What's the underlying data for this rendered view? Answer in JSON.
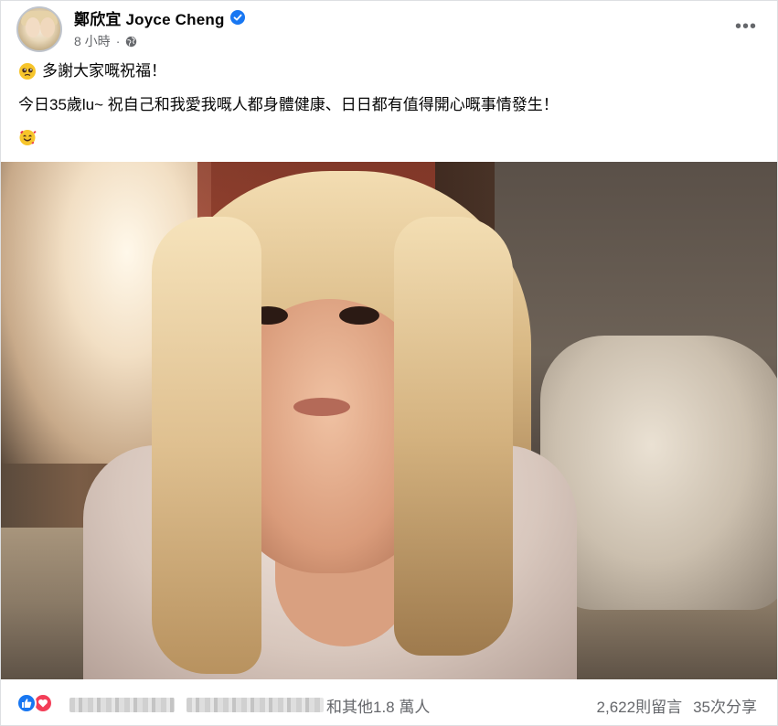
{
  "post": {
    "author": "鄭欣宜 Joyce Cheng",
    "time": "8 小時",
    "lines": [
      {
        "emoji": "pleading-face",
        "text": "多謝大家嘅祝福！"
      },
      {
        "emoji": "",
        "text": "今日35歲lu~ 祝自己和我愛我嘅人都身體健康、日日都有值得開心嘅事情發生！"
      },
      {
        "emoji": "smiling-face-with-hearts",
        "text": ""
      }
    ]
  },
  "footer": {
    "reaction_text": "和其他1.8 萬人",
    "comments": "2,622則留言",
    "shares": "35次分享"
  },
  "icons": {
    "verified": "verified-badge-icon",
    "privacy": "globe-icon",
    "more": "more-options-icon",
    "like": "like-reaction-icon",
    "love": "love-reaction-icon"
  },
  "colors": {
    "brand_blue": "#1877f2",
    "love_red": "#f33e58",
    "secondary_text": "#65676b",
    "primary_text": "#050505"
  }
}
